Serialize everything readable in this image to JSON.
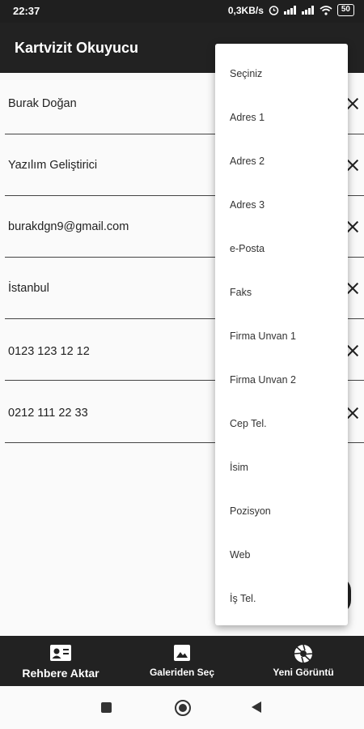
{
  "status": {
    "time": "22:37",
    "speed": "0,3KB/s",
    "battery": "50"
  },
  "appbar": {
    "title": "Kartvizit Okuyucu"
  },
  "fields": [
    {
      "value": "Burak Doğan"
    },
    {
      "value": "Yazılım Geliştirici"
    },
    {
      "value": "burakdgn9@gmail.com"
    },
    {
      "value": "İstanbul"
    },
    {
      "value": "0123 123 12 12"
    },
    {
      "value": "0212 111 22 33"
    }
  ],
  "menu": {
    "items": [
      "Seçiniz",
      "Adres 1",
      "Adres 2",
      "Adres 3",
      "e-Posta",
      "Faks",
      "Firma Unvan 1",
      "Firma Unvan 2",
      "Cep Tel.",
      "İsim",
      "Pozisyon",
      "Web",
      "İş Tel."
    ]
  },
  "bottom": {
    "export_label": "Rehbere Aktar",
    "gallery_label": "Galeriden Seç",
    "camera_label": "Yeni Görüntü"
  }
}
